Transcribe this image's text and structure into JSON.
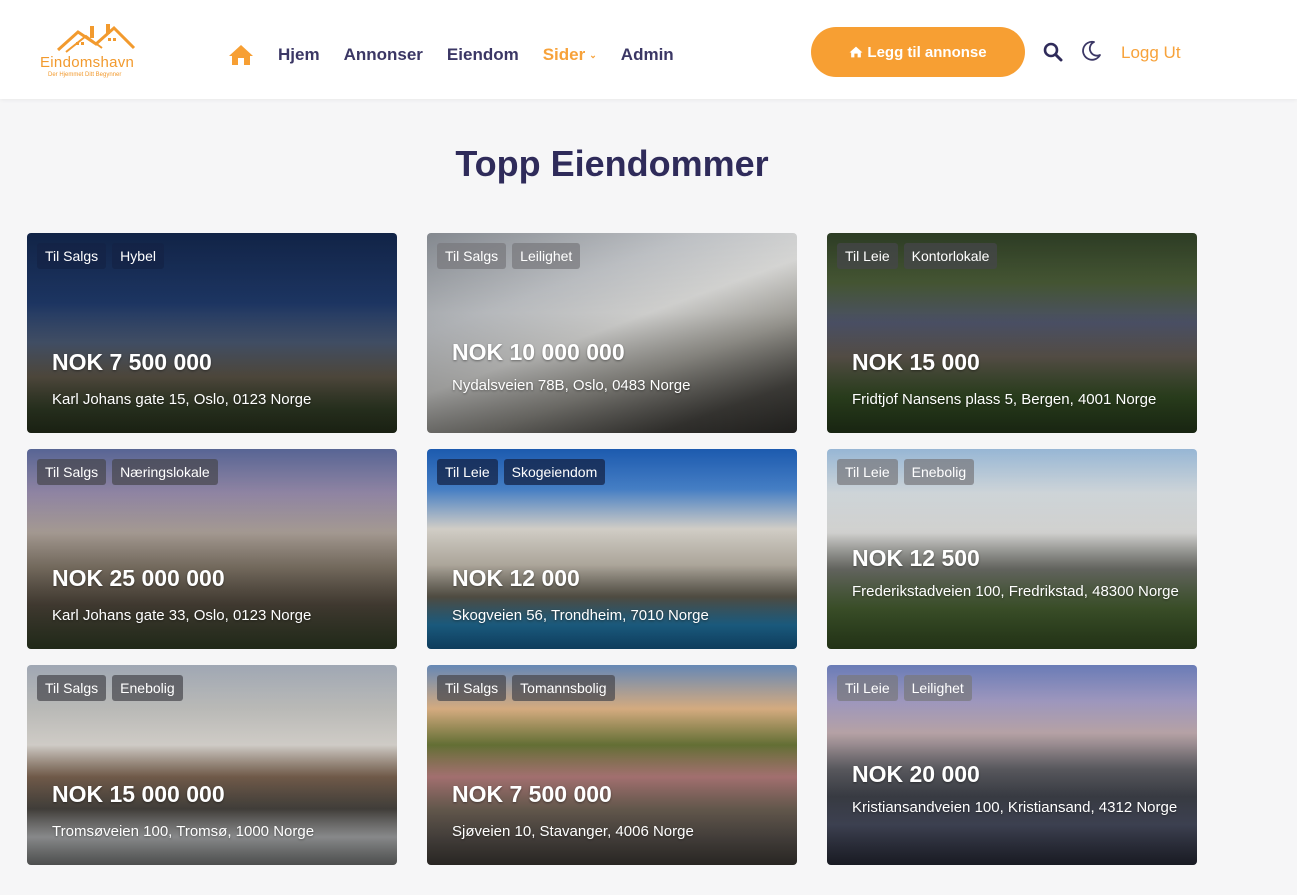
{
  "brand": {
    "name": "Eindomshavn",
    "tagline": "Der Hjemmet Ditt Begynner"
  },
  "colors": {
    "accent": "#f79f33",
    "navy": "#2f2b5a"
  },
  "nav": {
    "home_icon": "home-icon",
    "items": [
      {
        "label": "Hjem",
        "active": false
      },
      {
        "label": "Annonser",
        "active": false
      },
      {
        "label": "Eiendom",
        "active": false
      },
      {
        "label": "Sider",
        "active": true,
        "has_dropdown": true
      },
      {
        "label": "Admin",
        "active": false
      }
    ]
  },
  "header": {
    "add_button": "Legg til annonse",
    "logout": "Logg Ut"
  },
  "section": {
    "title": "Topp Eiendommer"
  },
  "listings": [
    {
      "status": "Til Salgs",
      "type": "Hybel",
      "price": "NOK 7 500 000",
      "address": "Karl Johans gate 15, Oslo, 0123 Norge"
    },
    {
      "status": "Til Salgs",
      "type": "Leilighet",
      "price": "NOK 10 000 000",
      "address": "Nydalsveien 78B, Oslo, 0483 Norge"
    },
    {
      "status": "Til Leie",
      "type": "Kontorlokale",
      "price": "NOK 15 000",
      "address": "Fridtjof Nansens plass 5, Bergen, 4001 Norge"
    },
    {
      "status": "Til Salgs",
      "type": "Næringslokale",
      "price": "NOK 25 000 000",
      "address": "Karl Johans gate 33, Oslo, 0123 Norge"
    },
    {
      "status": "Til Leie",
      "type": "Skogeiendom",
      "price": "NOK 12 000",
      "address": "Skogveien 56, Trondheim, 7010 Norge"
    },
    {
      "status": "Til Leie",
      "type": "Enebolig",
      "price": "NOK 12 500",
      "address": "Frederikstadveien 100, Fredrikstad, 48300 Norge"
    },
    {
      "status": "Til Salgs",
      "type": "Enebolig",
      "price": "NOK 15 000 000",
      "address": "Tromsøveien 100, Tromsø, 1000 Norge"
    },
    {
      "status": "Til Salgs",
      "type": "Tomannsbolig",
      "price": "NOK 7 500 000",
      "address": "Sjøveien 10, Stavanger, 4006 Norge"
    },
    {
      "status": "Til Leie",
      "type": "Leilighet",
      "price": "NOK 20 000",
      "address": "Kristiansandveien 100, Kristiansand, 4312 Norge"
    }
  ]
}
